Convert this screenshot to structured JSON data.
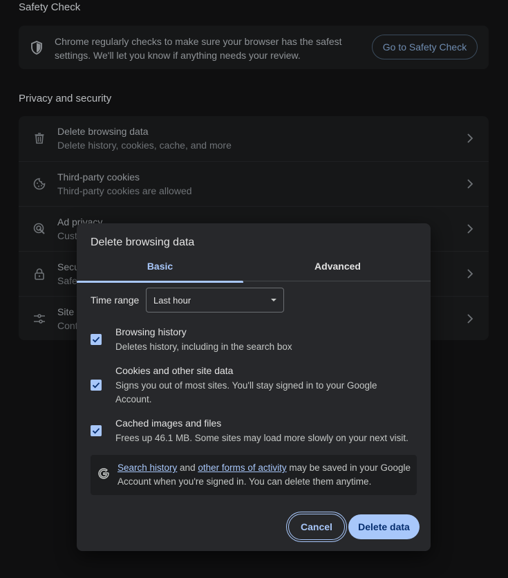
{
  "safety_check": {
    "section_title": "Safety Check",
    "description": "Chrome regularly checks to make sure your browser has the safest settings. We'll let you know if anything needs your review.",
    "button_label": "Go to Safety Check"
  },
  "privacy": {
    "section_title": "Privacy and security",
    "rows": [
      {
        "title": "Delete browsing data",
        "subtitle": "Delete history, cookies, cache, and more",
        "icon": "trash-icon"
      },
      {
        "title": "Third-party cookies",
        "subtitle": "Third-party cookies are allowed",
        "icon": "cookie-icon"
      },
      {
        "title": "Ad privacy",
        "subtitle": "Cust",
        "icon": "ad-privacy-icon"
      },
      {
        "title": "Secu",
        "subtitle": "Safe",
        "icon": "lock-icon"
      },
      {
        "title": "Site",
        "subtitle": "Cont",
        "icon": "tune-icon"
      }
    ]
  },
  "dialog": {
    "title": "Delete browsing data",
    "tabs": [
      {
        "label": "Basic",
        "selected": true
      },
      {
        "label": "Advanced",
        "selected": false
      }
    ],
    "time_range": {
      "label": "Time range",
      "value": "Last hour"
    },
    "options": [
      {
        "title": "Browsing history",
        "description": "Deletes history, including in the search box",
        "checked": true
      },
      {
        "title": "Cookies and other site data",
        "description": "Signs you out of most sites. You'll stay signed in to your Google Account.",
        "checked": true
      },
      {
        "title": "Cached images and files",
        "description": "Frees up 46.1 MB. Some sites may load more slowly on your next visit.",
        "checked": true
      }
    ],
    "google_notice": {
      "link1": "Search history",
      "text1": " and ",
      "link2": "other forms of activity",
      "text2": " may be saved in your Google Account when you're signed in. You can delete them anytime."
    },
    "cancel_label": "Cancel",
    "delete_label": "Delete data"
  },
  "colors": {
    "accent": "#a8c7fa",
    "dialog_bg": "#27282b",
    "page_bg": "#0f0f10"
  }
}
